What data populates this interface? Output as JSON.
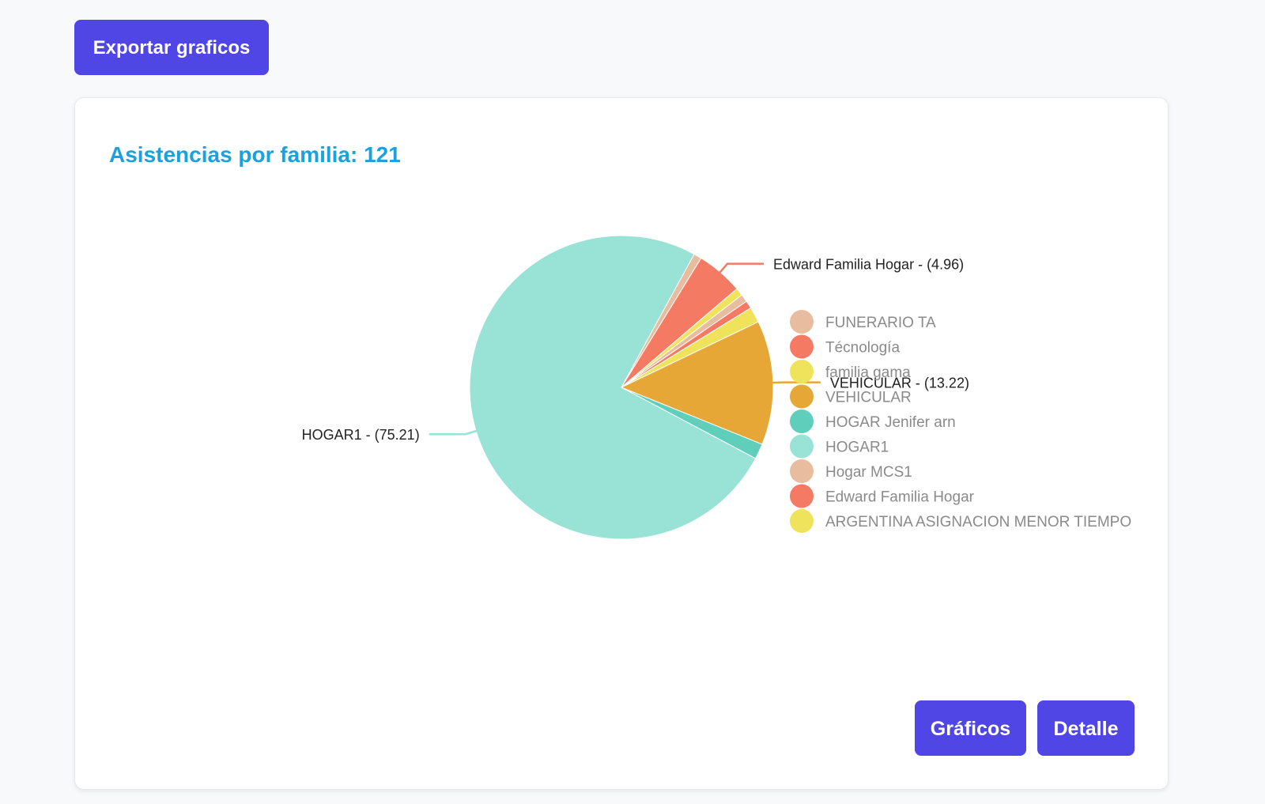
{
  "toolbar": {
    "export_label": "Exportar graficos"
  },
  "card": {
    "title": "Asistencias por familia: 121",
    "graficos_label": "Gráficos",
    "detalle_label": "Detalle"
  },
  "colors": {
    "primary_button": "#4f46e5",
    "title": "#1ba1dd"
  },
  "chart_data": {
    "type": "pie",
    "title": "Asistencias por familia: 121",
    "legend_position": "right",
    "slices": [
      {
        "name": "HOGAR Jenifer arn",
        "value": 1.65,
        "color": "#5fcfbb"
      },
      {
        "name": "HOGAR1",
        "value": 75.21,
        "color": "#98e3d5",
        "label": "HOGAR1 - (75.21)"
      },
      {
        "name": "Hogar MCS1",
        "value": 0.83,
        "color": "#e8bd9f"
      },
      {
        "name": "Edward Familia Hogar",
        "value": 4.96,
        "color": "#f47a64",
        "label": "Edward Familia Hogar - (4.96)"
      },
      {
        "name": "ARGENTINA ASIGNACION MENOR TIEMPO",
        "value": 0.83,
        "color": "#f0e35c"
      },
      {
        "name": "FUNERARIO TA",
        "value": 0.83,
        "color": "#e8bd9f"
      },
      {
        "name": "Técnología",
        "value": 0.83,
        "color": "#f47a64"
      },
      {
        "name": "familia gama",
        "value": 1.65,
        "color": "#f0e35c"
      },
      {
        "name": "VEHICULAR",
        "value": 13.22,
        "color": "#e6a737",
        "label": "VEHICULAR - (13.22)"
      }
    ],
    "legend": [
      {
        "name": "FUNERARIO TA",
        "color": "#e8bd9f"
      },
      {
        "name": "Técnología",
        "color": "#f47a64"
      },
      {
        "name": "familia gama",
        "color": "#f0e35c"
      },
      {
        "name": "VEHICULAR",
        "color": "#e6a737"
      },
      {
        "name": "HOGAR Jenifer arn",
        "color": "#5fcfbb"
      },
      {
        "name": "HOGAR1",
        "color": "#98e3d5"
      },
      {
        "name": "Hogar MCS1",
        "color": "#e8bd9f"
      },
      {
        "name": "Edward Familia Hogar",
        "color": "#f47a64"
      },
      {
        "name": "ARGENTINA ASIGNACION MENOR TIEMPO",
        "color": "#f0e35c"
      }
    ]
  }
}
